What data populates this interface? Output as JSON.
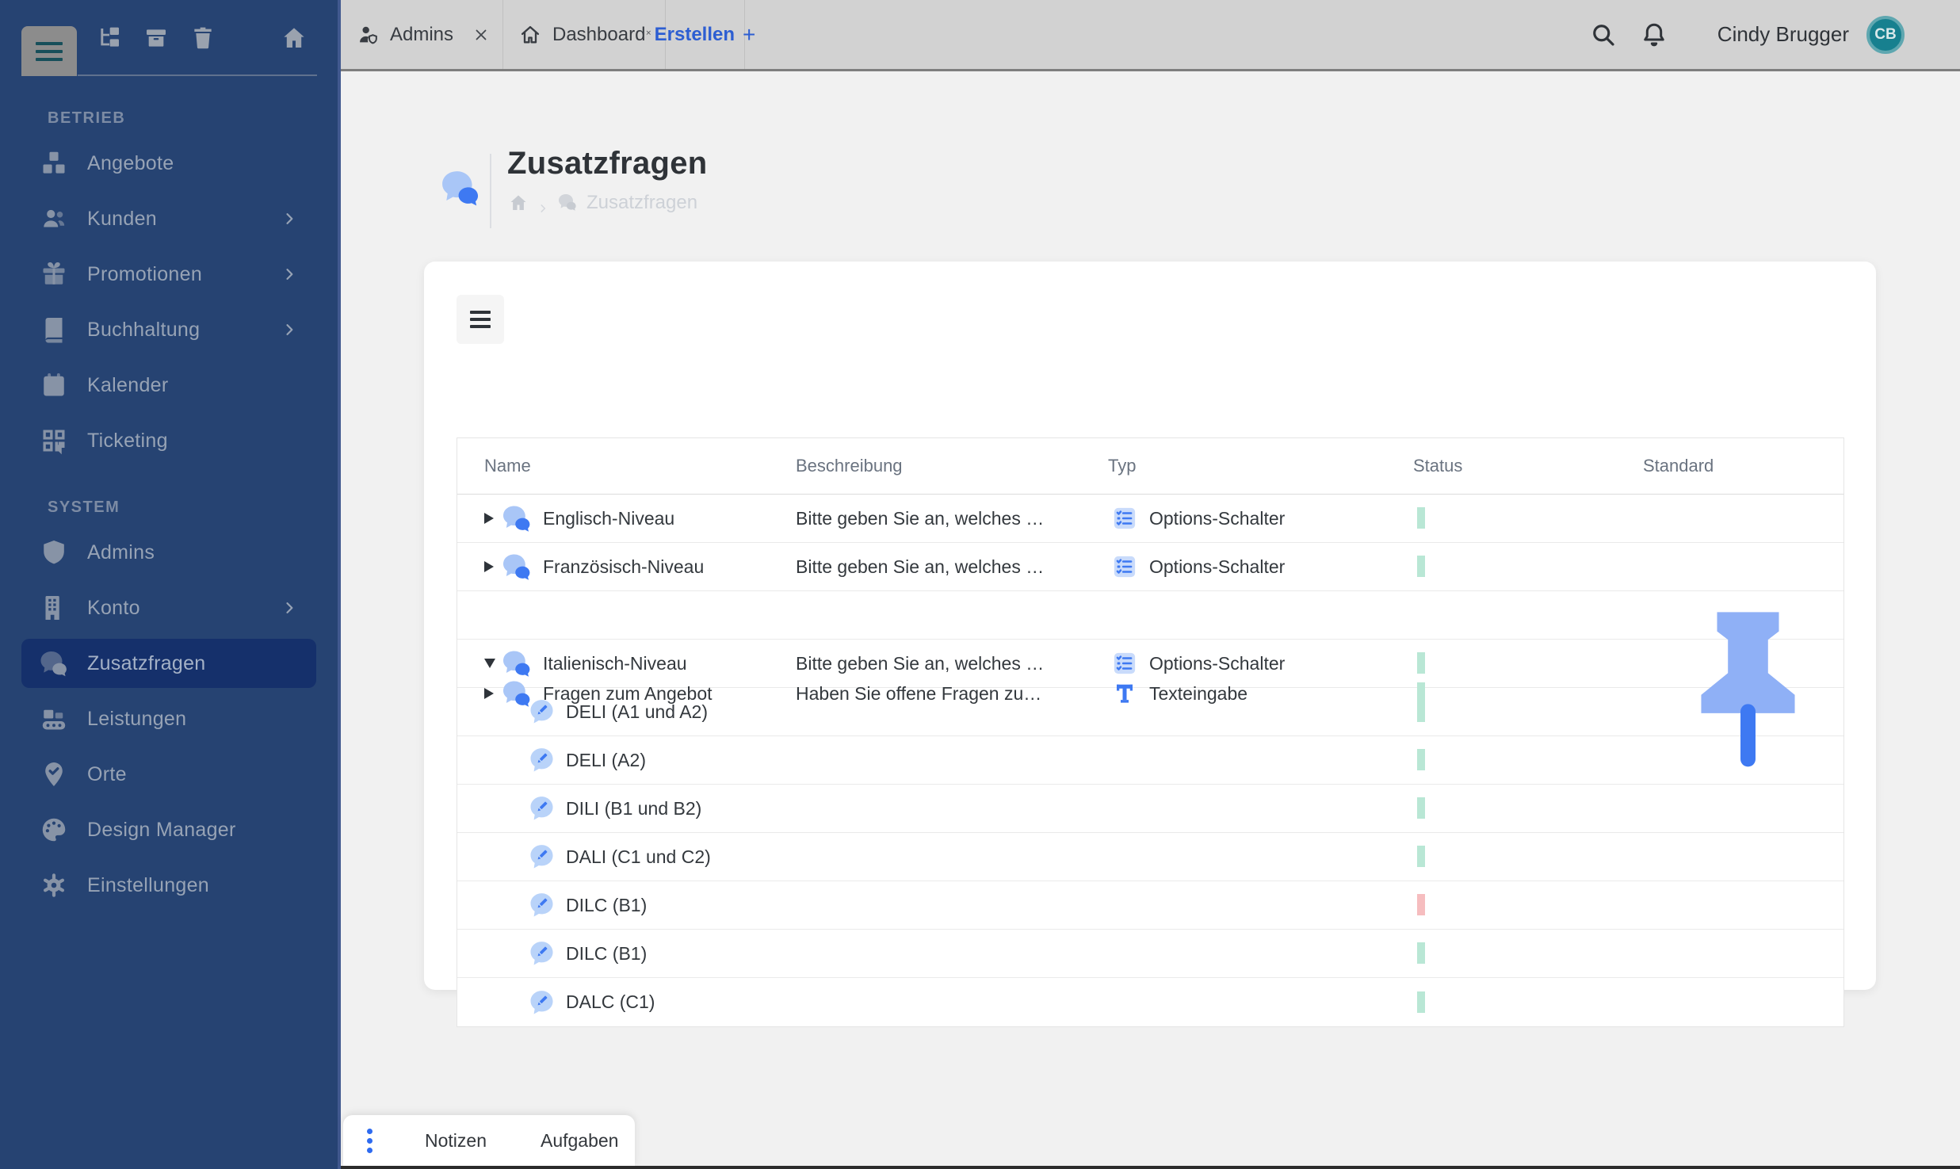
{
  "colors": {
    "sidebar_bg": "#264372",
    "sidebar_active_bg": "#15306B",
    "topbar_bg": "#D2D2D2",
    "accent_blue": "#2D5ED2",
    "icon_blue": "#3E79F2",
    "icon_blue_light": "#C9DBFB",
    "status_green": "#3FBE8E",
    "status_red": "#E4636B",
    "avatar_bg": "#17808F"
  },
  "topbar": {
    "tabs": [
      {
        "label": "Admins",
        "icon": "user-shield-icon",
        "close_icon": "close-icon"
      },
      {
        "label": "Dashboard",
        "icon": "home-icon",
        "close_icon": "close-icon"
      }
    ],
    "create_tab": {
      "label": "Erstellen",
      "plus": "+"
    },
    "search_icon": "search-icon",
    "bell_icon": "bell-icon",
    "user_name": "Cindy Brugger",
    "avatar_initials": "CB"
  },
  "sidebar": {
    "header_icons": [
      "menu-icon",
      "tree-icon",
      "archive-icon",
      "trash-icon",
      "home-icon"
    ],
    "sections": [
      {
        "label": "BETRIEB",
        "items": [
          {
            "label": "Angebote",
            "icon": "cubes-icon",
            "chevron": false,
            "active": false
          },
          {
            "label": "Kunden",
            "icon": "users-icon",
            "chevron": true,
            "active": false
          },
          {
            "label": "Promotionen",
            "icon": "gift-icon",
            "chevron": true,
            "active": false
          },
          {
            "label": "Buchhaltung",
            "icon": "book-icon",
            "chevron": true,
            "active": false
          },
          {
            "label": "Kalender",
            "icon": "calendar-icon",
            "chevron": false,
            "active": false
          },
          {
            "label": "Ticketing",
            "icon": "qr-icon",
            "chevron": false,
            "active": false
          }
        ]
      },
      {
        "label": "SYSTEM",
        "items": [
          {
            "label": "Admins",
            "icon": "shield-icon",
            "chevron": false,
            "active": false
          },
          {
            "label": "Konto",
            "icon": "building-icon",
            "chevron": true,
            "active": false
          },
          {
            "label": "Zusatzfragen",
            "icon": "chat-icon",
            "chevron": false,
            "active": true
          },
          {
            "label": "Leistungen",
            "icon": "services-icon",
            "chevron": false,
            "active": false
          },
          {
            "label": "Orte",
            "icon": "pin-check-icon",
            "chevron": false,
            "active": false
          },
          {
            "label": "Design Manager",
            "icon": "palette-icon",
            "chevron": false,
            "active": false
          },
          {
            "label": "Einstellungen",
            "icon": "gear-icon",
            "chevron": false,
            "active": false
          }
        ]
      }
    ]
  },
  "page": {
    "title": "Zusatzfragen",
    "title_icon": "chat-bubbles-icon",
    "breadcrumb": {
      "home_icon": "home-icon",
      "item_icon": "chat-bubbles-icon",
      "current": "Zusatzfragen"
    }
  },
  "table": {
    "columns": [
      "Name",
      "Beschreibung",
      "Typ",
      "Status",
      "Standard"
    ],
    "rows": [
      {
        "level": 0,
        "expander": "collapsed",
        "icon": "chat-bubbles-icon",
        "name": "Englisch-Niveau",
        "description": "Bitte geben Sie an, welches …",
        "type_label": "Options-Schalter",
        "type_icon": "options-list-icon",
        "status": "green",
        "standard": false
      },
      {
        "level": 0,
        "expander": "collapsed",
        "icon": "chat-bubbles-icon",
        "name": "Französisch-Niveau",
        "description": "Bitte geben Sie an, welches …",
        "type_label": "Options-Schalter",
        "type_icon": "options-list-icon",
        "status": "green",
        "standard": false
      },
      {
        "level": 0,
        "expander": "collapsed",
        "icon": "chat-bubbles-icon",
        "name": "Fragen zum Angebot",
        "description": "Haben Sie offene Fragen zu…",
        "type_label": "Texteingabe",
        "type_icon": "text-input-icon",
        "status": "green",
        "standard": true
      },
      {
        "level": 0,
        "expander": "expanded",
        "icon": "chat-bubbles-icon",
        "name": "Italienisch-Niveau",
        "description": "Bitte geben Sie an, welches …",
        "type_label": "Options-Schalter",
        "type_icon": "options-list-icon",
        "status": "green",
        "standard": false
      },
      {
        "level": 1,
        "icon": "pencil-bubble-icon",
        "name": "DELI (A1 und A2)",
        "description": "",
        "type_label": "",
        "status": "green",
        "standard": false
      },
      {
        "level": 1,
        "icon": "pencil-bubble-icon",
        "name": "DELI (A2)",
        "description": "",
        "type_label": "",
        "status": "green",
        "standard": false
      },
      {
        "level": 1,
        "icon": "pencil-bubble-icon",
        "name": "DILI (B1 und B2)",
        "description": "",
        "type_label": "",
        "status": "green",
        "standard": false
      },
      {
        "level": 1,
        "icon": "pencil-bubble-icon",
        "name": "DALI (C1 und C2)",
        "description": "",
        "type_label": "",
        "status": "green",
        "standard": false
      },
      {
        "level": 1,
        "icon": "pencil-bubble-icon",
        "name": "DILC (B1)",
        "description": "",
        "type_label": "",
        "status": "red",
        "standard": false
      },
      {
        "level": 1,
        "icon": "pencil-bubble-icon",
        "name": "DILC (B1)",
        "description": "",
        "type_label": "",
        "status": "green",
        "standard": false
      },
      {
        "level": 1,
        "icon": "pencil-bubble-icon",
        "name": "DALC (C1)",
        "description": "",
        "type_label": "",
        "status": "green",
        "standard": false
      }
    ]
  },
  "bottombar": {
    "menu_icon": "kebab-icon",
    "items": [
      "Notizen",
      "Aufgaben"
    ]
  }
}
